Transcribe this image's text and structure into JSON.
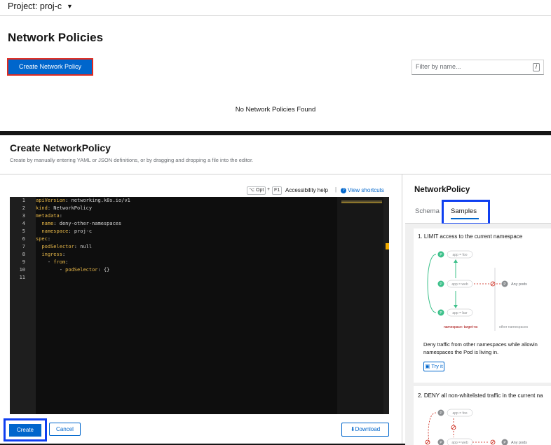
{
  "top": {
    "project_label": "Project: proj-c",
    "page_title": "Network Policies",
    "create_button": "Create Network Policy",
    "filter_placeholder": "Filter by name...",
    "filter_shortcut": "/",
    "empty_message": "No Network Policies Found"
  },
  "create": {
    "title": "Create NetworkPolicy",
    "subtitle": "Create by manually entering YAML or JSON definitions, or by dragging and dropping a file into the editor.",
    "toolbar": {
      "kbd_opt": "⌥ Opt",
      "kbd_plus": "+",
      "kbd_f1": "F1",
      "accessibility_help": "Accessibility help",
      "separator": "|",
      "view_shortcuts": "View shortcuts",
      "view_shortcuts_icon": "help-circle-icon"
    },
    "editor": {
      "line_numbers": [
        "1",
        "2",
        "3",
        "4",
        "5",
        "6",
        "7",
        "8",
        "9",
        "10",
        "11"
      ],
      "lines": [
        {
          "indent": "",
          "key": "apiVersion",
          "sep": ": ",
          "value": "networking.k8s.io/v1"
        },
        {
          "indent": "",
          "key": "kind",
          "sep": ": ",
          "value": "NetworkPolicy"
        },
        {
          "indent": "",
          "key": "metadata",
          "sep": ":",
          "value": ""
        },
        {
          "indent": "  ",
          "key": "name",
          "sep": ": ",
          "value": "deny-other-namespaces"
        },
        {
          "indent": "  ",
          "key": "namespace",
          "sep": ": ",
          "value": "proj-c"
        },
        {
          "indent": "",
          "key": "spec",
          "sep": ":",
          "value": ""
        },
        {
          "indent": "  ",
          "key": "podSelector",
          "sep": ": ",
          "value": "null"
        },
        {
          "indent": "  ",
          "key": "ingress",
          "sep": ":",
          "value": ""
        },
        {
          "indent": "    - ",
          "key": "from",
          "sep": ":",
          "value": ""
        },
        {
          "indent": "        - ",
          "key": "podSelector",
          "sep": ": ",
          "value": "{}"
        },
        {
          "indent": "",
          "key": "",
          "sep": "",
          "value": ""
        }
      ]
    },
    "buttons": {
      "create": "Create",
      "cancel": "Cancel",
      "download": "Download",
      "download_icon": "download-icon"
    }
  },
  "sidebar": {
    "title": "NetworkPolicy",
    "tabs": [
      "Schema",
      "Samples"
    ],
    "active_tab": "Samples",
    "sample1": {
      "title": "1. LIMIT access to the current namespace",
      "pods": [
        "app = foo",
        "app = web",
        "app = bar"
      ],
      "any_pods": "Any pods",
      "ns_label": "namespace: target-ns",
      "other_ns": "other namespaces",
      "desc_line1": "Deny traffic from other namespaces while allowin",
      "desc_line2": "namespaces the Pod is living in.",
      "try_it": "Try it",
      "try_it_icon": "clipboard-icon"
    },
    "sample2": {
      "title": "2. DENY all non-whitelisted traffic in the current na",
      "pods": [
        "app = foo",
        "app = web"
      ],
      "any_pods": "Any pods"
    }
  },
  "colors": {
    "primary": "#0066cc",
    "highlight_red": "#e02b20",
    "highlight_blue": "#0f3ff0",
    "pod_green": "#3cc08a",
    "deny_red": "#c9190b",
    "editor_bg": "#0e0e0e",
    "yaml_key": "#e9b949"
  }
}
